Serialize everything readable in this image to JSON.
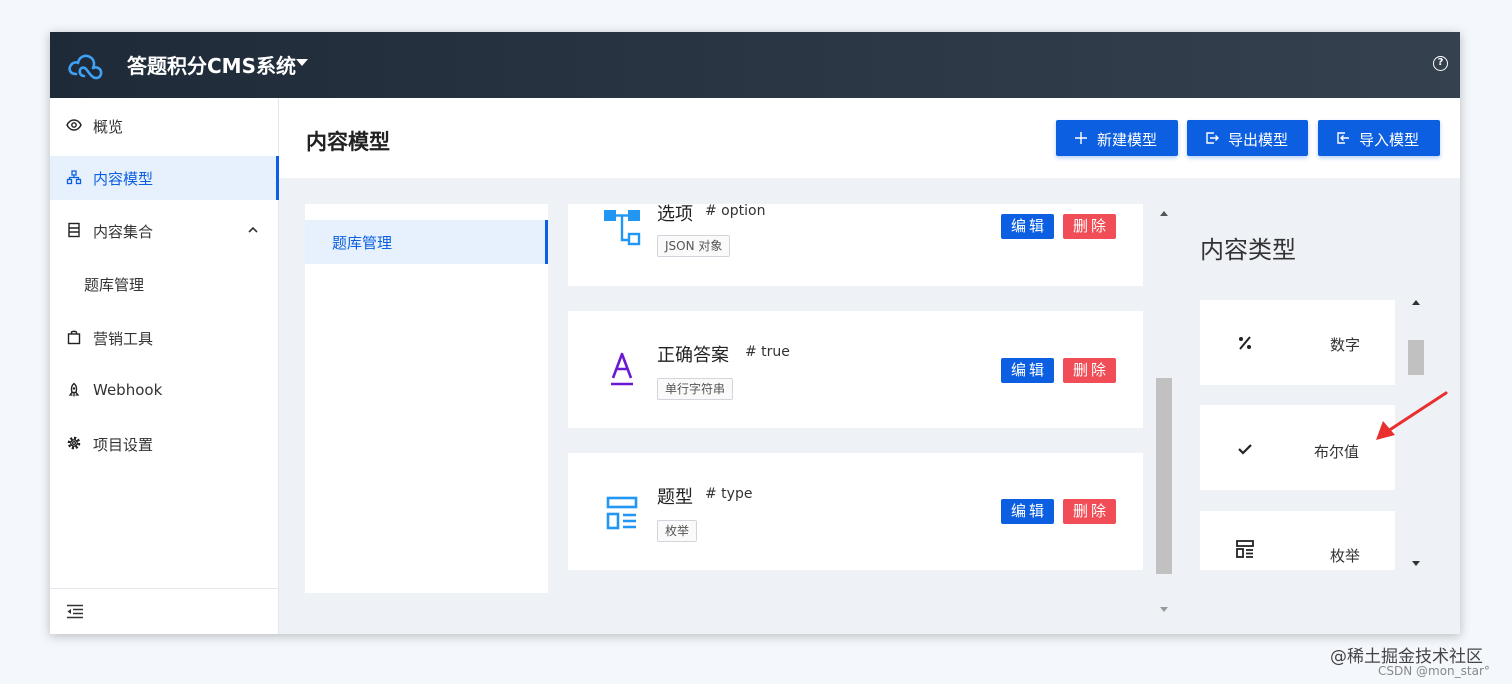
{
  "app": {
    "title": "答题积分CMS系统"
  },
  "sidebar": {
    "items": [
      {
        "label": "概览"
      },
      {
        "label": "内容模型"
      },
      {
        "label": "内容集合"
      },
      {
        "label": "题库管理"
      },
      {
        "label": "营销工具"
      },
      {
        "label": "Webhook"
      },
      {
        "label": "项目设置"
      }
    ]
  },
  "header": {
    "title": "内容模型",
    "new_model": "新建模型",
    "export_model": "导出模型",
    "import_model": "导入模型"
  },
  "models": {
    "items": [
      {
        "label": "题库管理"
      }
    ]
  },
  "fields": {
    "edit_label": "编辑",
    "delete_label": "删除",
    "items": [
      {
        "name": "选项",
        "id": "# option",
        "type": "JSON 对象",
        "icon": "json-tree-icon"
      },
      {
        "name": "正确答案",
        "id": "# true",
        "type": "单行字符串",
        "icon": "text-a-icon"
      },
      {
        "name": "题型",
        "id": "# type",
        "type": "枚举",
        "icon": "enum-list-icon"
      }
    ]
  },
  "content_types": {
    "title": "内容类型",
    "items": [
      {
        "label": "数字",
        "icon": "percent-icon"
      },
      {
        "label": "布尔值",
        "icon": "check-icon"
      },
      {
        "label": "枚举",
        "icon": "enum-list-icon"
      }
    ]
  },
  "watermark": {
    "text": "@稀土掘金技术社区",
    "subtext": "CSDN @mon_star°"
  },
  "colors": {
    "primary": "#0c5fe0",
    "danger": "#f04d57",
    "topbar": "#2a3542",
    "accent_icon": "#2196f3",
    "purple_icon": "#6a1bd1",
    "annotation_arrow": "#e8302e"
  }
}
